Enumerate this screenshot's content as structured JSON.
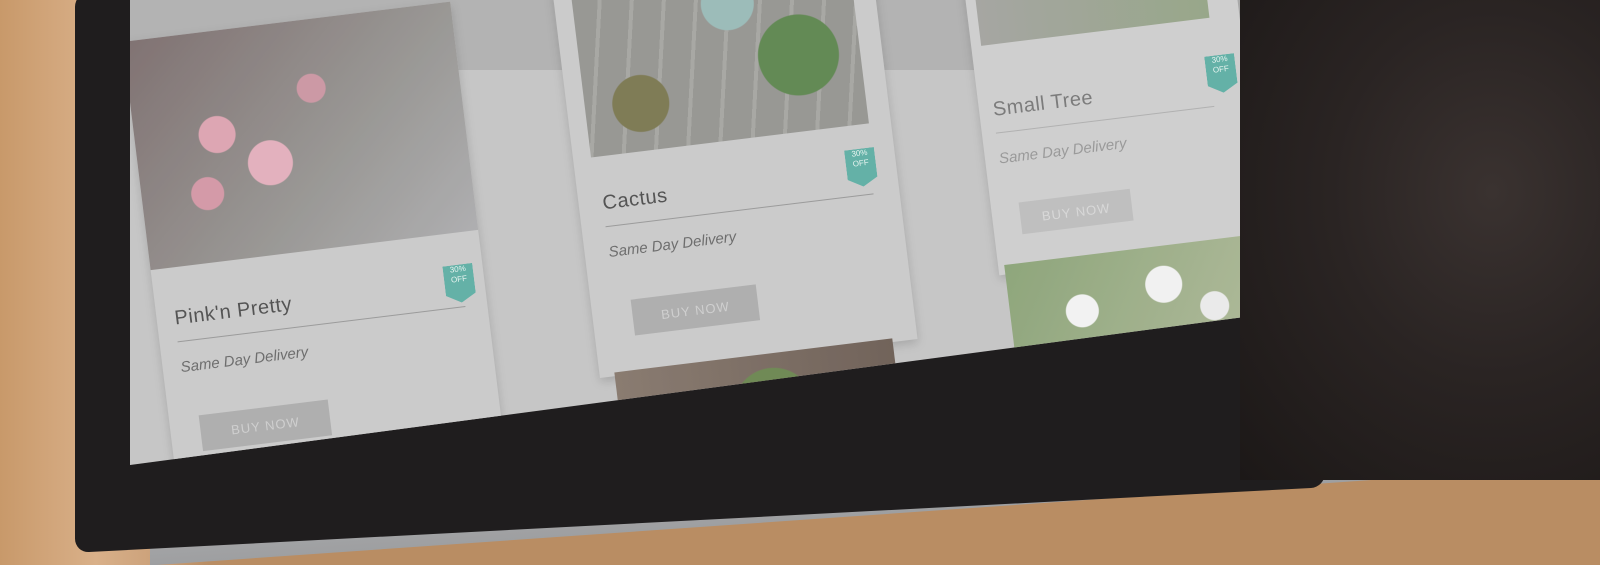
{
  "products": [
    {
      "title": "Pink'n Pretty",
      "delivery": "Same Day Delivery",
      "badge_top": "30%",
      "badge_bottom": "OFF",
      "button": "BUY NOW"
    },
    {
      "title": "Cactus",
      "delivery": "Same Day Delivery",
      "badge_top": "30%",
      "badge_bottom": "OFF",
      "button": "BUY NOW"
    },
    {
      "title": "Small Tree",
      "delivery": "Same Day Delivery",
      "badge_top": "30%",
      "badge_bottom": "OFF",
      "button": "BUY NOW"
    }
  ],
  "colors": {
    "badge": "#4fa79b",
    "card": "#c4c4c4",
    "button": "#a4a4a4"
  },
  "icons": [
    "discount-badge-icon"
  ]
}
